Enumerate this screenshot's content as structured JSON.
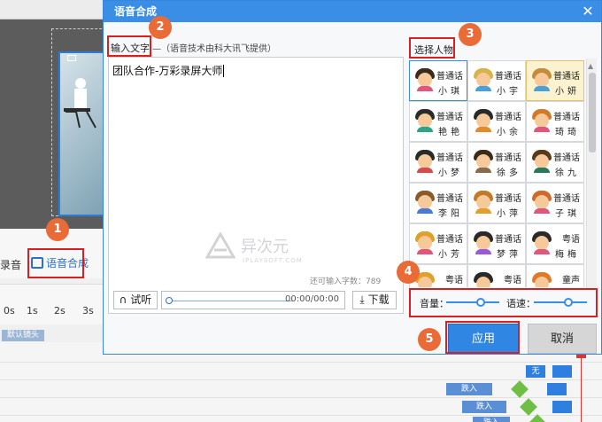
{
  "background_editor": {
    "left_tool_label": "录音",
    "speech_tool_label": "语音合成",
    "timeline_ticks": [
      "0s",
      "1s",
      "2s",
      "3s"
    ],
    "track_label": "默认镜头",
    "clips": [
      "无",
      "跌入",
      "跌入",
      "跌入"
    ]
  },
  "dialog": {
    "title": "语音合成",
    "close_glyph": "✕",
    "input_label": "输入文字",
    "tech_note": "—（语音技术由科大讯飞提供）",
    "text_value": "团队合作-万彩录屏大师",
    "char_counter": "还可输入字数：789",
    "listen_label": "试听",
    "listen_icon": "headphones-icon",
    "player_time": "00:00/00:00",
    "download_label": "下载",
    "download_icon": "download-icon",
    "character_label": "选择人物",
    "characters": [
      {
        "lang": "普通话",
        "name": "小琪",
        "hair": "#3b2a1e",
        "body": "#e0567c",
        "selected": false,
        "highlight": true
      },
      {
        "lang": "普通话",
        "name": "小宇",
        "hair": "#d8b24a",
        "body": "#4aa0d8",
        "selected": false
      },
      {
        "lang": "普通话",
        "name": "小妍",
        "hair": "#c58a3a",
        "body": "#4aa0d8",
        "selected": true
      },
      {
        "lang": "普通话",
        "name": "艳艳",
        "hair": "#2a2a2a",
        "body": "#2aa58a",
        "selected": false
      },
      {
        "lang": "普通话",
        "name": "小余",
        "hair": "#2a2a2a",
        "body": "#e08a2a",
        "selected": false
      },
      {
        "lang": "普通话",
        "name": "琦琦",
        "hair": "#d07a2a",
        "body": "#e0567c",
        "selected": false
      },
      {
        "lang": "普通话",
        "name": "小梦",
        "hair": "#2a2a2a",
        "body": "#d84a4a",
        "selected": false
      },
      {
        "lang": "普通话",
        "name": "徐多",
        "hair": "#3a2a1a",
        "body": "#8a6a4a",
        "selected": false
      },
      {
        "lang": "普通话",
        "name": "徐九",
        "hair": "#5a3a1a",
        "body": "#2a7a5a",
        "selected": false
      },
      {
        "lang": "普通话",
        "name": "李阳",
        "hair": "#8a5a2a",
        "body": "#4a7ad8",
        "selected": false
      },
      {
        "lang": "普通话",
        "name": "小萍",
        "hair": "#c07a2a",
        "body": "#e0a02a",
        "selected": false
      },
      {
        "lang": "普通话",
        "name": "子琪",
        "hair": "#d06a2a",
        "body": "#e0567c",
        "selected": false
      },
      {
        "lang": "普通话",
        "name": "小芳",
        "hair": "#e0a02a",
        "body": "#e0567c",
        "selected": false
      },
      {
        "lang": "普通话",
        "name": "梦萍",
        "hair": "#2a2a2a",
        "body": "#9a5ad8",
        "selected": false
      },
      {
        "lang": "粤语",
        "name": "梅梅",
        "hair": "#2a2a2a",
        "body": "#e0567c",
        "selected": false
      },
      {
        "lang": "粤语",
        "name": "",
        "hair": "#e0a02a",
        "body": "#e0567c",
        "selected": false
      },
      {
        "lang": "粤语",
        "name": "",
        "hair": "#2a2a2a",
        "body": "#4aa0d8",
        "selected": false
      },
      {
        "lang": "童声",
        "name": "",
        "hair": "#e07a2a",
        "body": "#e0567c",
        "selected": false
      }
    ],
    "volume_label": "音量：",
    "speed_label": "语速：",
    "volume_level": 0.65,
    "speed_level": 0.65,
    "apply_label": "应用",
    "cancel_label": "取消"
  },
  "annotations": [
    "1",
    "2",
    "3",
    "4",
    "5"
  ],
  "watermark": {
    "title": "异次元",
    "subtitle": "IPLAYSOFT.COM"
  },
  "colors": {
    "accent": "#3a8ee6",
    "badge": "#e96b38",
    "highlight_border": "#d82020"
  }
}
